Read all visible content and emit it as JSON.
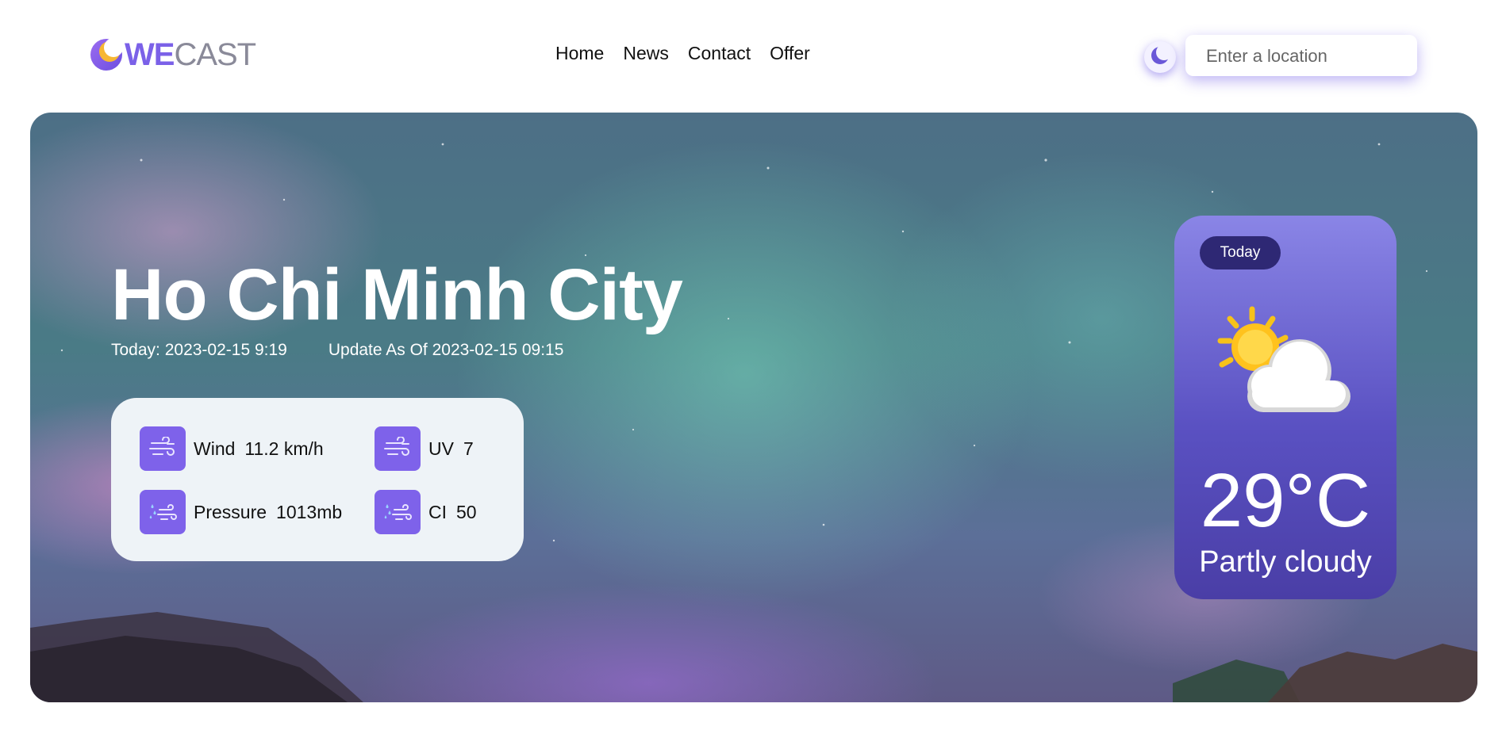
{
  "brand": {
    "name_part1": "WE",
    "name_part2": "CAST",
    "logo_icon": "crescent-moon-icon"
  },
  "nav": {
    "items": [
      {
        "label": "Home"
      },
      {
        "label": "News"
      },
      {
        "label": "Contact"
      },
      {
        "label": "Offer"
      }
    ]
  },
  "theme_toggle": {
    "icon": "moon-icon"
  },
  "search": {
    "placeholder": "Enter a location",
    "value": ""
  },
  "hero": {
    "city": "Ho Chi Minh City",
    "today_label": "Today: 2023-02-15 9:19",
    "updated_label": "Update As Of 2023-02-15 09:15"
  },
  "stats": {
    "wind": {
      "label": "Wind",
      "value": "11.2 km/h",
      "icon": "wind-icon"
    },
    "uv": {
      "label": "UV",
      "value": "7",
      "icon": "wind-icon"
    },
    "pressure": {
      "label": "Pressure",
      "value": "1013mb",
      "icon": "rain-wind-icon"
    },
    "ci": {
      "label": "CI",
      "value": "50",
      "icon": "rain-wind-icon"
    }
  },
  "today_card": {
    "badge": "Today",
    "icon": "partly-cloudy-icon",
    "temperature": "29°C",
    "condition": "Partly cloudy"
  },
  "colors": {
    "accent": "#7e62ea",
    "card_top": "#8a85e6",
    "card_bottom": "#4a3ea6",
    "badge_bg": "#2e2874",
    "stats_bg": "#eef3f7"
  }
}
